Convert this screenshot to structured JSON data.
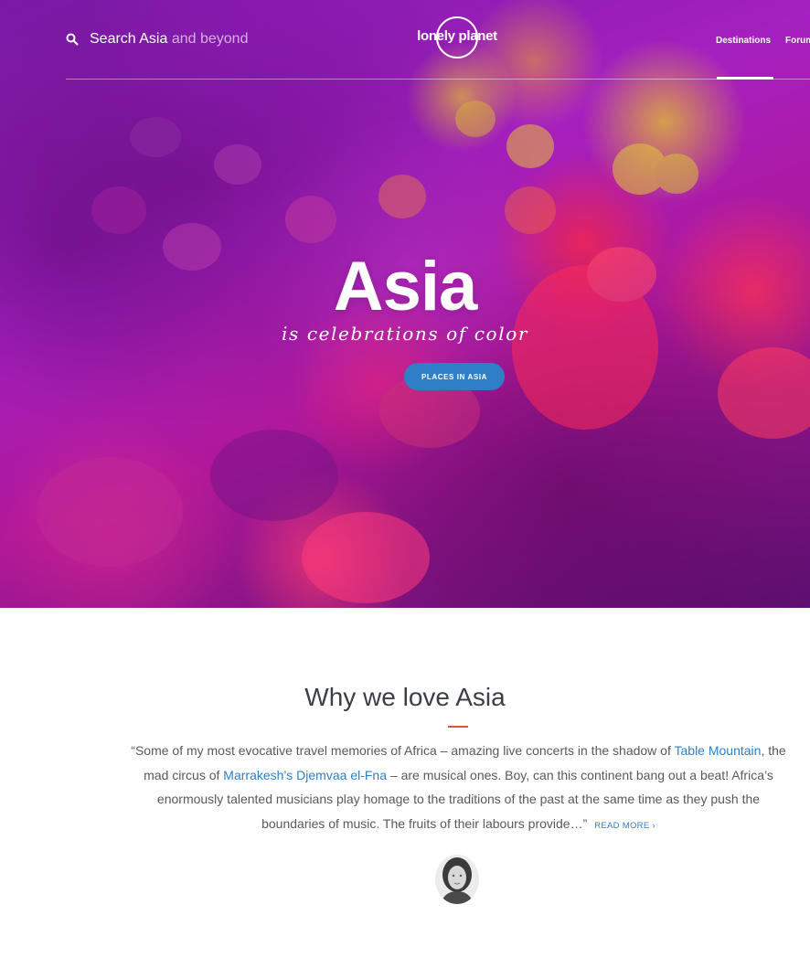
{
  "header": {
    "search_placeholder": "Search Asia and beyond",
    "search_prefix": "Search Asia",
    "search_suffix": " and beyond",
    "logo_text": "lonely planet",
    "nav": [
      {
        "label": "Destinations",
        "active": true
      },
      {
        "label": "Forum",
        "active": false
      }
    ]
  },
  "hero": {
    "title": "Asia",
    "subtitle": "is celebrations of color",
    "cta_label": "PLACES IN ASIA"
  },
  "intro": {
    "heading": "Why we love Asia",
    "quote_part1": "“Some of my most evocative travel memories of Africa – amazing live concerts in the shadow of ",
    "link1": "Table Mountain",
    "quote_part2": ", the mad circus of ",
    "link2": "Marrakesh’s Djemvaa el-Fna",
    "quote_part3": " – are musical ones. Boy, can this continent bang out a beat! Africa’s enormously talented musicians play homage to the traditions of the past at the same time  as they push the boundaries of music. The fruits of their labours provide…”",
    "read_more": "READ MORE ›"
  },
  "colors": {
    "accent_blue": "#2f7fc6",
    "title_rule": "#d9573f",
    "heading": "#3b4048",
    "body_text": "#555a60"
  },
  "icons": [
    "search-icon"
  ]
}
